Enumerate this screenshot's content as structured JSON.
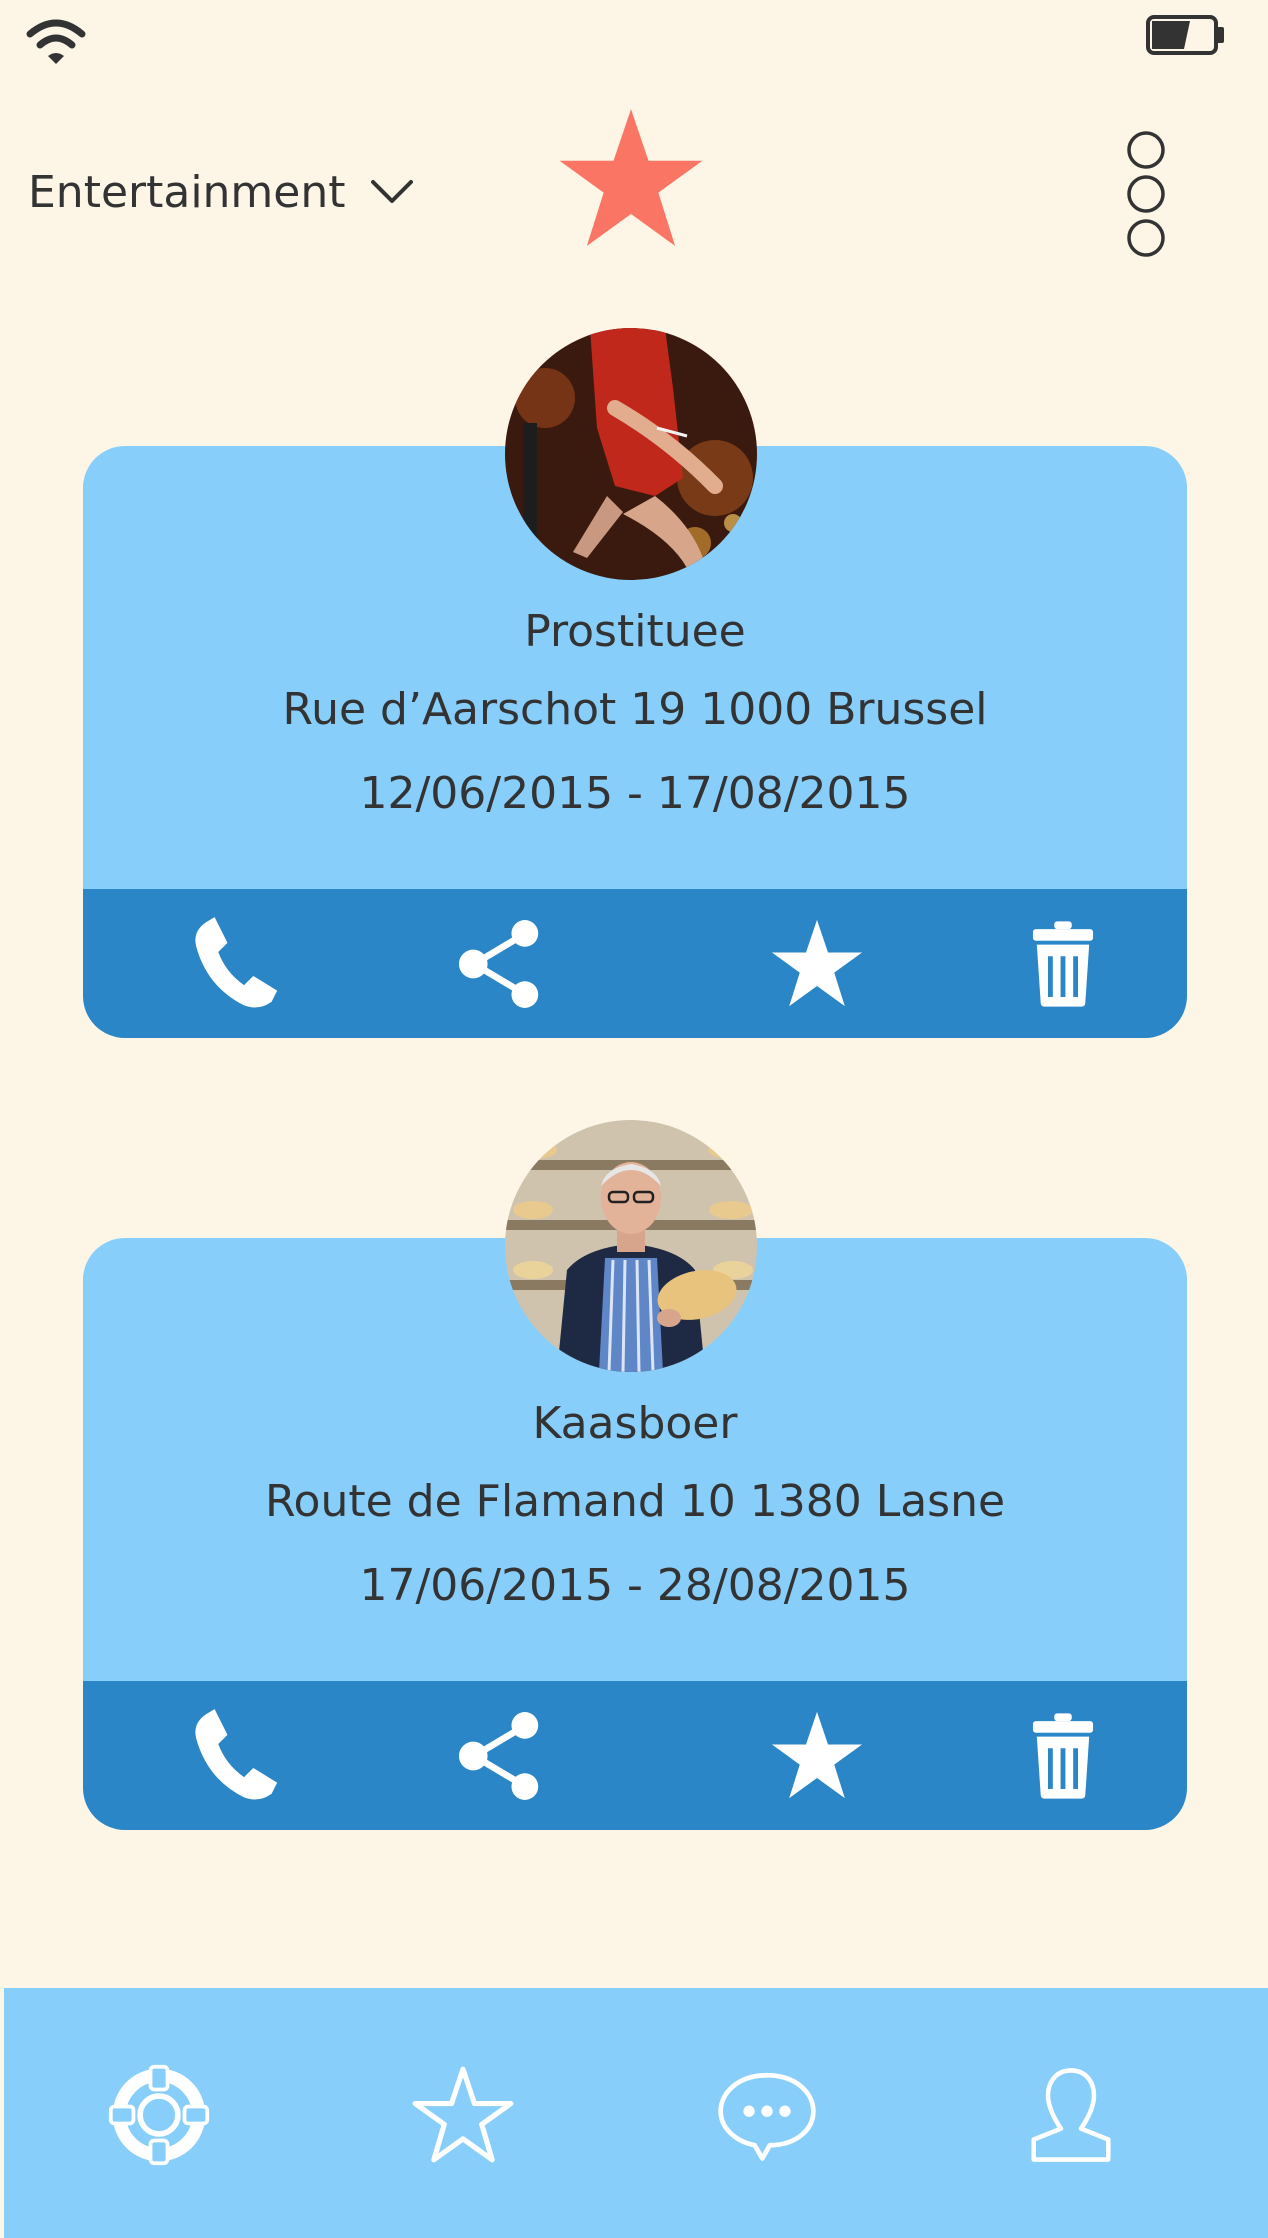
{
  "status_bar": {
    "wifi_icon": "wifi-icon",
    "battery_icon": "battery-icon"
  },
  "header": {
    "category": "Entertainment",
    "chevron_icon": "chevron-down-icon",
    "favorite_icon": "star-icon",
    "menu_icon": "more-vertical-icon"
  },
  "cards": [
    {
      "name": "Prostituee",
      "address": "Rue d’Aarschot 19  1000 Brussel",
      "dates": "12/06/2015 - 17/08/2015",
      "actions": [
        "phone-icon",
        "share-icon",
        "star-icon",
        "trash-icon"
      ]
    },
    {
      "name": "Kaasboer",
      "address": "Route de Flamand 10  1380 Lasne",
      "dates": "17/06/2015 - 28/08/2015",
      "actions": [
        "phone-icon",
        "share-icon",
        "star-icon",
        "trash-icon"
      ]
    }
  ],
  "tab_bar": {
    "tabs": [
      "lifebuoy-icon",
      "star-outline-icon",
      "chat-icon",
      "user-icon"
    ]
  },
  "colors": {
    "background": "#fdf5e6",
    "card": "#87cefa",
    "card_actions": "#2a86c6",
    "accent_star": "#fa7564",
    "text": "#333333"
  }
}
